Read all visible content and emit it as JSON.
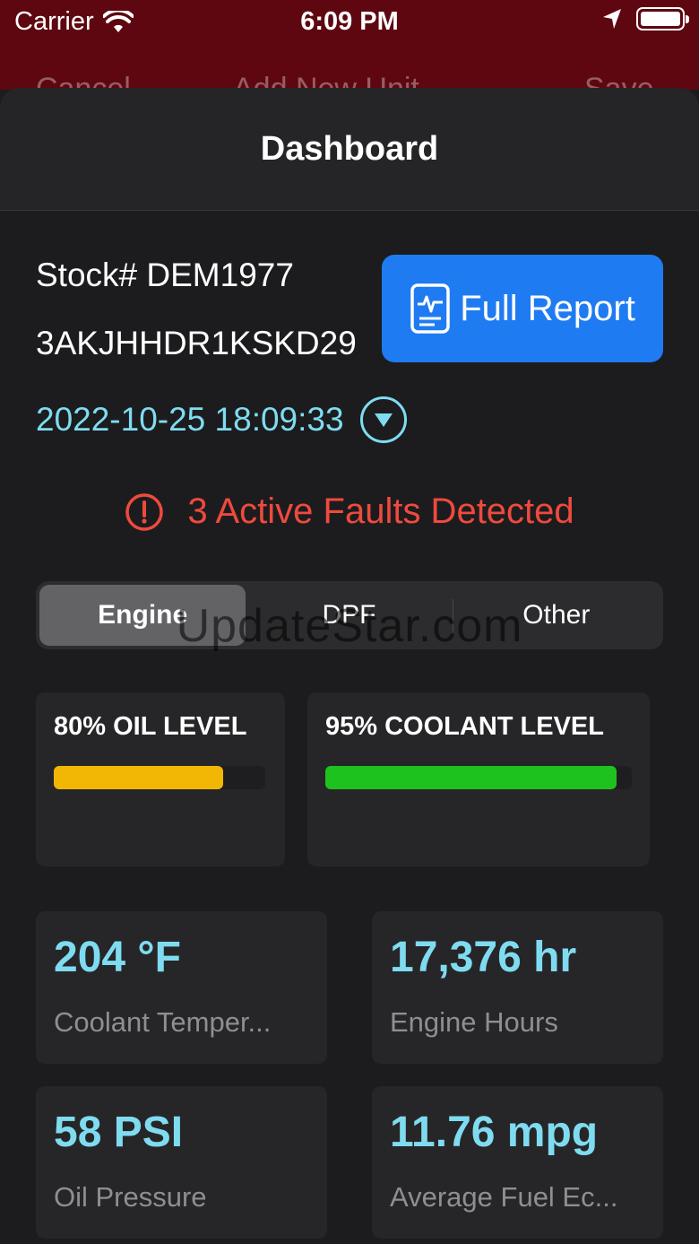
{
  "status_bar": {
    "carrier": "Carrier",
    "time": "6:09 PM"
  },
  "under_nav": {
    "left": "Cancel",
    "title": "Add New Unit",
    "right": "Save"
  },
  "sheet": {
    "title": "Dashboard"
  },
  "unit": {
    "stock": "Stock# DEM1977",
    "vin": "3AKJHHDR1KSKD29",
    "timestamp": "2022-10-25 18:09:33"
  },
  "full_report": {
    "label": "Full Report"
  },
  "faults": {
    "text": "3 Active Faults Detected"
  },
  "tabs": [
    {
      "label": "Engine",
      "active": true
    },
    {
      "label": "DPF",
      "active": false
    },
    {
      "label": "Other",
      "active": false
    }
  ],
  "watermark": "UpdateStar.com",
  "levels": [
    {
      "title": "80% OIL LEVEL",
      "value": 0.8,
      "color": "#f2b705"
    },
    {
      "title": "95% COOLANT LEVEL",
      "value": 0.95,
      "color": "#1ec21e"
    }
  ],
  "metrics": [
    {
      "value": "204 °F",
      "label": "Coolant Temper..."
    },
    {
      "value": "17,376 hr",
      "label": "Engine Hours"
    },
    {
      "value": "58 PSI",
      "label": "Oil Pressure"
    },
    {
      "value": "11.76 mpg",
      "label": "Average Fuel Ec..."
    }
  ],
  "colors": {
    "accent": "#1f7bf2",
    "fault": "#ef4a3d",
    "value": "#7fdcf0",
    "status_bar": "#5e0711"
  }
}
